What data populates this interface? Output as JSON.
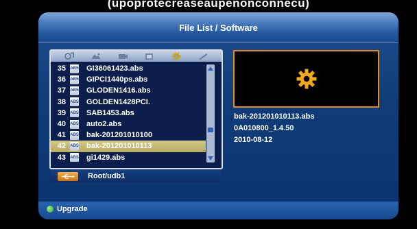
{
  "top_caption": "(upoprotecreaseaupenonconnecu)",
  "header": {
    "title": "File List / Software"
  },
  "tabs": [
    {
      "icon": "music-icon"
    },
    {
      "icon": "photo-icon"
    },
    {
      "icon": "film-icon"
    },
    {
      "icon": "video-icon"
    },
    {
      "icon": "software-icon"
    },
    {
      "icon": "tools-icon"
    }
  ],
  "files": [
    {
      "num": "35",
      "type": "ABS",
      "name": "GI36061423.abs"
    },
    {
      "num": "36",
      "type": "ABS",
      "name": "GIPCI1440ps.abs"
    },
    {
      "num": "37",
      "type": "ABS",
      "name": "GLODEN1416.abs"
    },
    {
      "num": "38",
      "type": "ABS",
      "name": "GOLDEN1428PCI."
    },
    {
      "num": "39",
      "type": "ABS",
      "name": "SAB1453.abs"
    },
    {
      "num": "40",
      "type": "ABS",
      "name": "auto2.abs"
    },
    {
      "num": "41",
      "type": "ABS",
      "name": "bak-201201010100"
    },
    {
      "num": "42",
      "type": "ABS",
      "name": "bak-201201010113"
    },
    {
      "num": "43",
      "type": "ABS",
      "name": "gi1429.abs"
    }
  ],
  "selected_index": 7,
  "path": "Root/udb1",
  "preview": {
    "icon": "gear-icon"
  },
  "info": {
    "filename": "bak-201201010113.abs",
    "version": "0A010800_1.4.50",
    "date": "2010-08-12"
  },
  "footer": {
    "upgrade_label": "Upgrade"
  },
  "colors": {
    "accent": "#e08a2a",
    "selected": "#c8bd76",
    "frame": "#0f3c78"
  }
}
